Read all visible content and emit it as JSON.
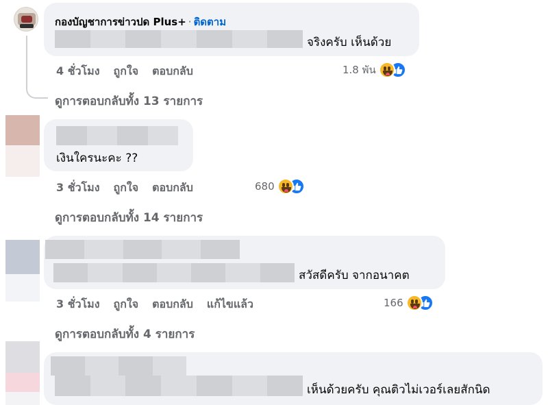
{
  "comments": [
    {
      "author_suffix": "กองบัญชาการข่าวปด Plus+",
      "separator": "·",
      "follow_label": "ติดตาม",
      "text": "จริงครับ เห็นด้วย",
      "time": "4 ชั่วโมง",
      "like_label": "ถูกใจ",
      "reply_label": "ตอบกลับ",
      "reaction_count": "1.8 พัน",
      "view_replies": "ดูการตอบกลับทั้ง 13 รายการ"
    },
    {
      "text": "เงินใครนะคะ ??",
      "time": "3 ชั่วโมง",
      "like_label": "ถูกใจ",
      "reply_label": "ตอบกลับ",
      "reaction_count": "680",
      "view_replies": "ดูการตอบกลับทั้ง 14 รายการ"
    },
    {
      "text": "สวัสดีครับ จากอนาคต",
      "time": "3 ชั่วโมง",
      "like_label": "ถูกใจ",
      "reply_label": "ตอบกลับ",
      "edited_label": "แก้ไขแล้ว",
      "reaction_count": "166",
      "view_replies": "ดูการตอบกลับทั้ง 4 รายการ"
    },
    {
      "text": "เห็นด้วยครับ คุณติวไม่เวอร์เลยสักนิด"
    }
  ],
  "icons": {
    "reaction_haha": "haha-emoji-icon",
    "reaction_like": "like-thumb-icon"
  },
  "colors": {
    "bubble": "#f0f2f5",
    "secondary_text": "#65676b",
    "follow_link": "#0064d1",
    "like_blue": "#1877f2",
    "haha_yellow": "#f7b928"
  }
}
